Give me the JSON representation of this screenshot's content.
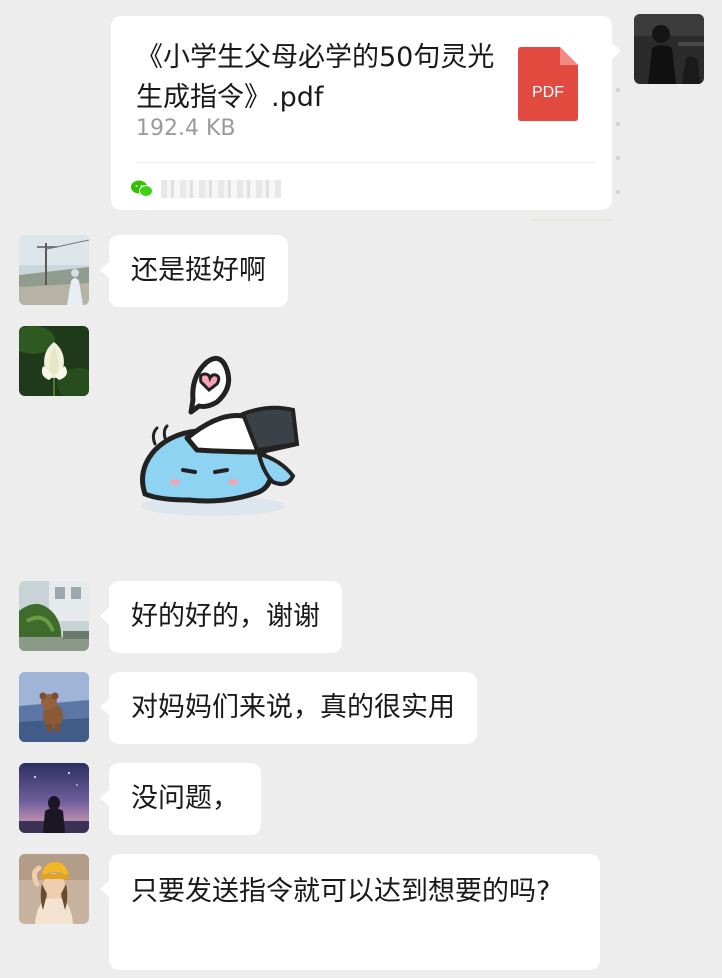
{
  "file_message": {
    "file_name": "《小学生父母必学的50句灵光生成指令》.pdf",
    "file_size": "192.4 KB",
    "file_type_label": "PDF",
    "file_icon": "pdf-file-icon",
    "source_icon": "wechat-icon"
  },
  "messages": [
    {
      "text": "还是挺好啊"
    },
    {
      "type": "sticker",
      "sticker": "blob-with-heart-sticker"
    },
    {
      "text": "好的好的，谢谢"
    },
    {
      "text": "对妈妈们来说，真的很实用"
    },
    {
      "text": "没问题，"
    },
    {
      "text": "只要发送指令就可以达到想要的吗?"
    }
  ],
  "colors": {
    "background": "#ededed",
    "bubble": "#ffffff",
    "text": "#191919",
    "pdf_red": "#e2493f",
    "wechat_green": "#2dc100"
  }
}
